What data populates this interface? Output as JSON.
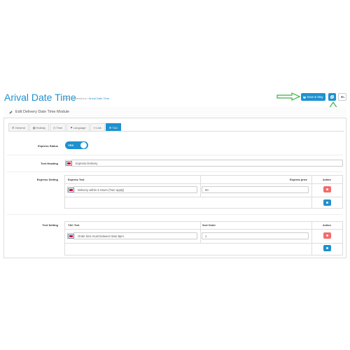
{
  "header": {
    "title": "Arival Date Time",
    "breadcrumb": [
      "Home",
      "Extensions",
      "Arival Date Time"
    ],
    "save_label": "Save & Stay",
    "copy_icon": "copy-icon",
    "back_icon": "reply-icon"
  },
  "panel": {
    "title": "Edit Delivery Date Time Module",
    "tabs": [
      {
        "label": "General",
        "icon": "gear-icon"
      },
      {
        "label": "Holiday",
        "icon": "calendar-icon"
      },
      {
        "label": "Time",
        "icon": "clock-icon"
      },
      {
        "label": "Language",
        "icon": "language-icon"
      },
      {
        "label": "Link",
        "icon": "link-icon"
      },
      {
        "label": "T&C",
        "icon": "gear-icon",
        "active": true
      }
    ]
  },
  "form": {
    "express_status": {
      "label": "Express Status",
      "value": "YES"
    },
    "text_heading": {
      "label": "Text Heading",
      "value": "Express Delivery"
    },
    "express_setting": {
      "label": "Express Setting",
      "columns": [
        "Express Text",
        "Express price",
        "Action"
      ],
      "rows": [
        {
          "text": "Delivery within 3 Hours (T&C apply)",
          "price": "50"
        }
      ]
    },
    "text_setting": {
      "label": "Text Setting",
      "columns": [
        "T&C Text",
        "Sort Order",
        "Action"
      ],
      "rows": [
        {
          "text": "Order time must between 9am-5pm",
          "sort": "1"
        }
      ]
    }
  },
  "colors": {
    "accent": "#1e91cf",
    "danger": "#f56b6b",
    "annotation": "#3cb043"
  }
}
